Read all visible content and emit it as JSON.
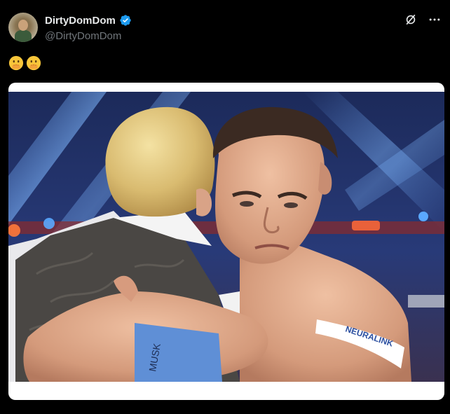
{
  "post": {
    "display_name": "DirtyDomDom",
    "handle": "@DirtyDomDom",
    "verified": true,
    "text": "🫢🫢",
    "image_text": {
      "wristband": "MUSK",
      "armband": "NEURALINK"
    }
  },
  "icons": {
    "verified": "verified-badge-icon",
    "grok": "grok-slash-icon",
    "more": "more-options-icon"
  },
  "colors": {
    "background": "#000000",
    "primary_text": "#e7e9ea",
    "secondary_text": "#71767b",
    "verified_blue": "#1d9bf0"
  }
}
